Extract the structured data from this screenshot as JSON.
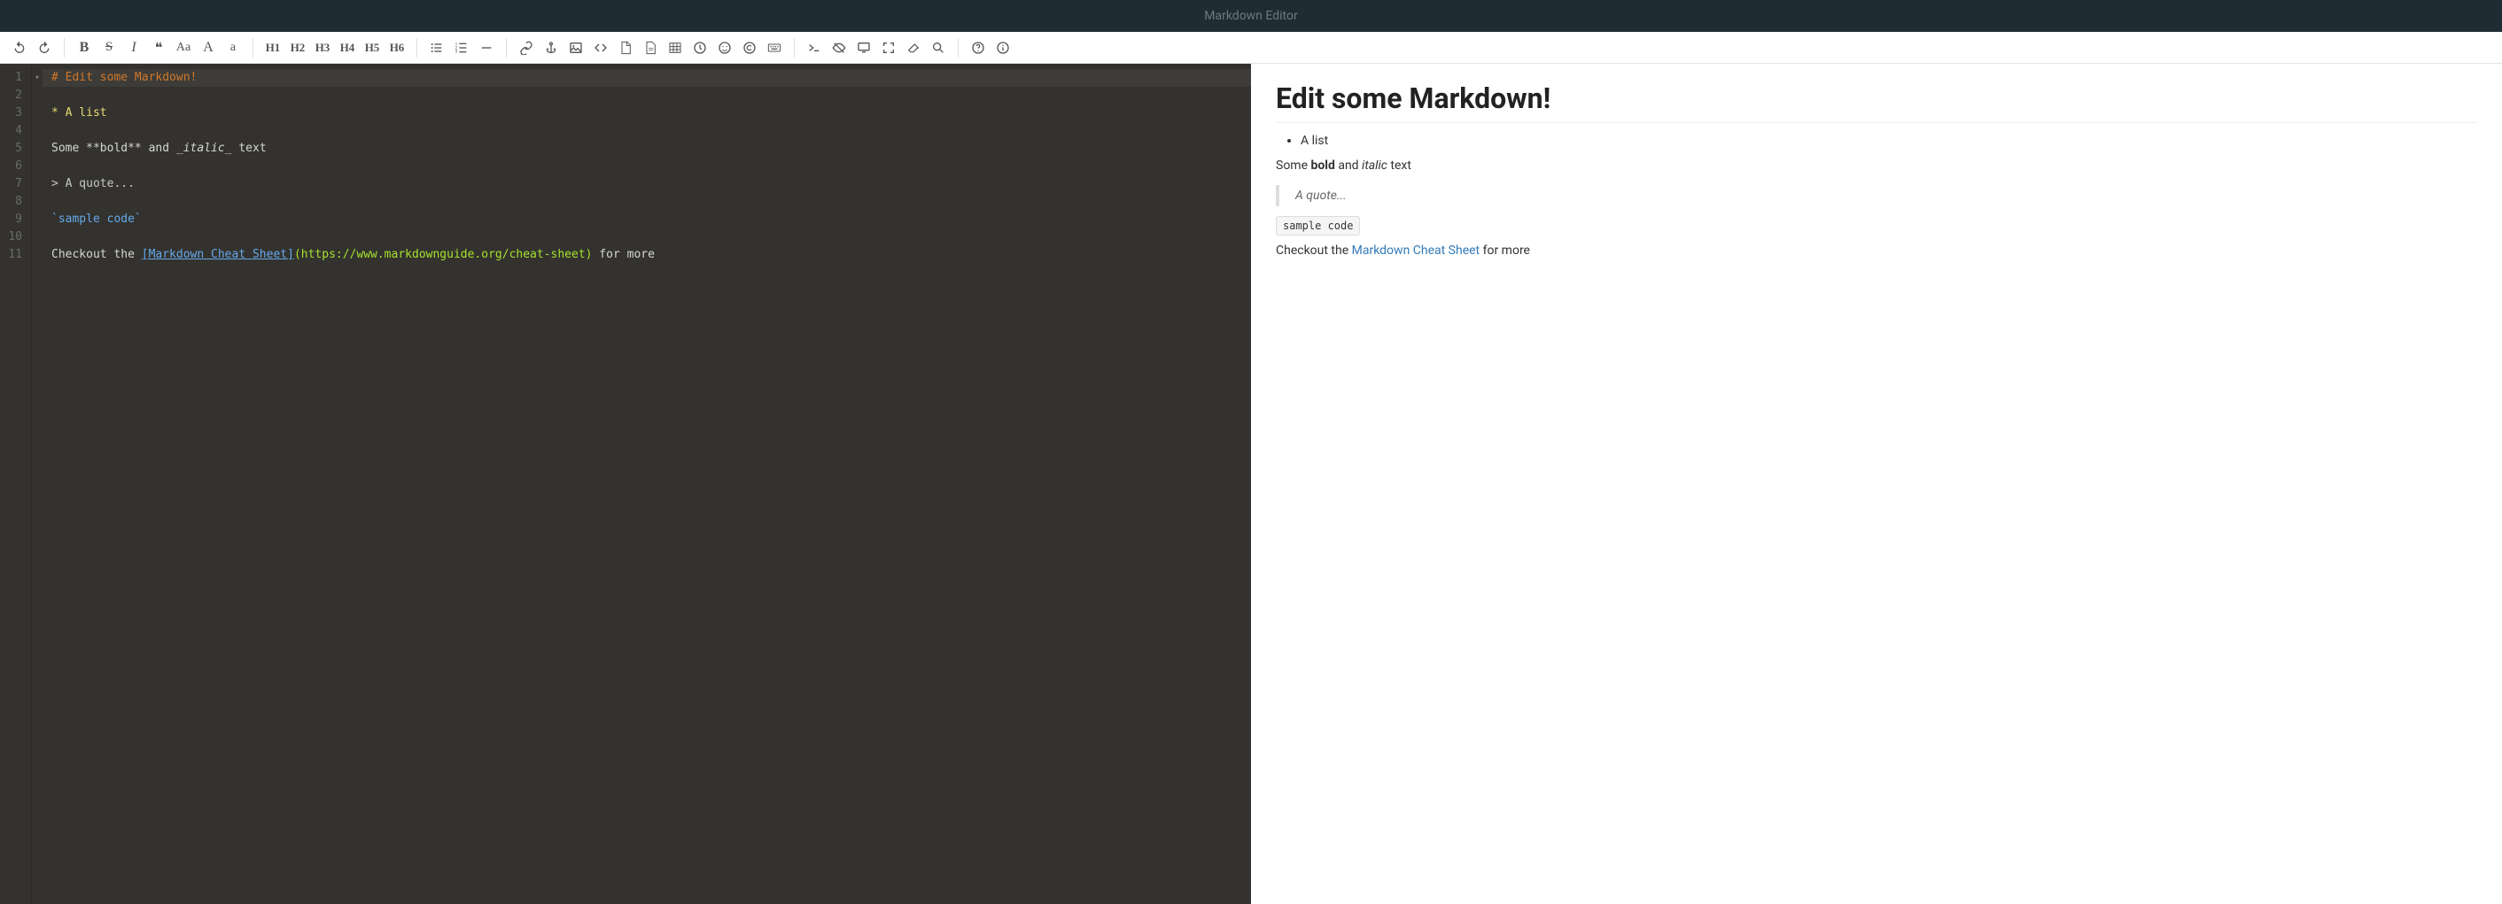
{
  "app_title": "Markdown Editor",
  "toolbar": {
    "undo": "Undo",
    "redo": "Redo",
    "bold": "B",
    "strike": "S",
    "italic": "I",
    "quote_glyph": "❝",
    "case_mixed": "Aa",
    "case_upper": "A",
    "case_lower": "a",
    "h1": "H1",
    "h2": "H2",
    "h3": "H3",
    "h4": "H4",
    "h5": "H5",
    "h6": "H6",
    "ul": "Unordered List",
    "ol": "Ordered List",
    "hr": "Horizontal Rule",
    "link": "Link",
    "anchor": "Anchor",
    "image": "Image",
    "code": "Code",
    "pdf": "PDF",
    "doc": "Doc",
    "table": "Table",
    "clock": "Datetime",
    "emoji": "Emoji",
    "copyright": "Copyright",
    "keyboard": "Keyboard",
    "terminal": "Terminal",
    "preview_toggle": "Toggle Preview",
    "device": "Device",
    "fullscreen": "Fullscreen",
    "clear": "Clear",
    "search": "Search",
    "help": "Help",
    "info": "Info"
  },
  "editor": {
    "lines": [
      {
        "n": 1,
        "fold": "▾",
        "raw": "# Edit some Markdown!",
        "cls": "tok-header",
        "hl": true
      },
      {
        "n": 2,
        "raw": ""
      },
      {
        "n": 3,
        "raw": "* A list",
        "cls": "tok-list"
      },
      {
        "n": 4,
        "raw": ""
      },
      {
        "n": 5,
        "segments": [
          {
            "t": "Some "
          },
          {
            "t": "**bold**"
          },
          {
            "t": " and "
          },
          {
            "t": "_italic_",
            "cls": "tok-em"
          },
          {
            "t": " text"
          }
        ]
      },
      {
        "n": 6,
        "raw": ""
      },
      {
        "n": 7,
        "raw": "> A quote...",
        "cls": "tok-quote"
      },
      {
        "n": 8,
        "raw": ""
      },
      {
        "n": 9,
        "raw": "`sample code`",
        "cls": "tok-code"
      },
      {
        "n": 10,
        "raw": ""
      },
      {
        "n": 11,
        "segments": [
          {
            "t": "Checkout the "
          },
          {
            "t": "[Markdown Cheat Sheet]",
            "cls": "tok-link"
          },
          {
            "t": "(https://www.markdownguide.org/cheat-sheet)",
            "cls": "tok-url"
          },
          {
            "t": " for more"
          }
        ]
      }
    ]
  },
  "preview": {
    "heading": "Edit some Markdown!",
    "list_item": "A list",
    "para1_pre": "Some ",
    "para1_bold": "bold",
    "para1_mid": " and ",
    "para1_italic": "italic",
    "para1_post": " text",
    "quote": "A quote...",
    "code": "sample code",
    "para2_pre": "Checkout the ",
    "para2_link": "Markdown Cheat Sheet",
    "para2_post": " for more"
  }
}
